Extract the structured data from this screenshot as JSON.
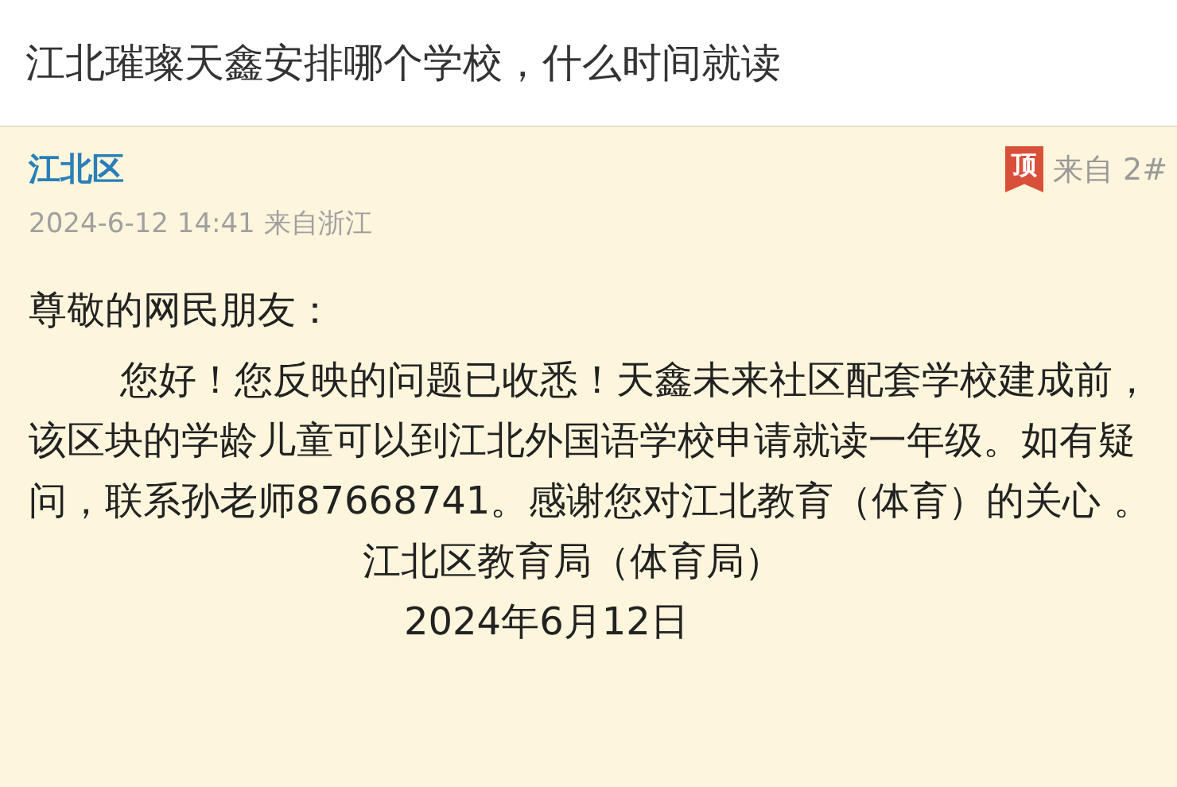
{
  "question": {
    "title": "江北璀璨天鑫安排哪个学校，什么时间就读"
  },
  "reply": {
    "author": "江北区",
    "badge": "顶",
    "source_label": "来自",
    "floor": "2#",
    "meta": "2024-6-12 14:41 来自浙江",
    "greeting": "尊敬的网民朋友：",
    "body": "您好！您反映的问题已收悉！天鑫未来社区配套学校建成前，该区块的学龄儿童可以到江北外国语学校申请就读一年级。如有疑问，联系孙老师87668741。感谢您对江北教育（体育）的关心 。",
    "signature": [
      "江北区教育局（体育局）",
      "2024年6月12日"
    ]
  }
}
